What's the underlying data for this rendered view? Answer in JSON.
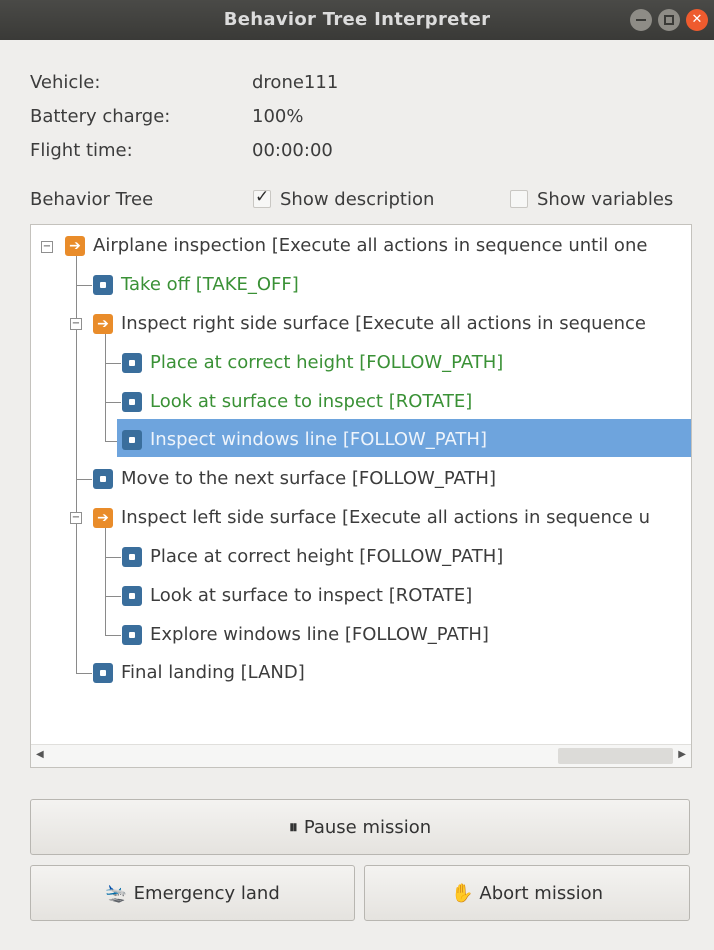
{
  "window": {
    "title": "Behavior Tree Interpreter"
  },
  "info": [
    {
      "label": "Vehicle:",
      "value": "drone111"
    },
    {
      "label": "Battery charge:",
      "value": "100%"
    },
    {
      "label": "Flight time:",
      "value": "00:00:00"
    }
  ],
  "behavior_tree": {
    "label": "Behavior Tree",
    "show_description": {
      "label": "Show description",
      "checked": true
    },
    "show_variables": {
      "label": "Show variables",
      "checked": false
    },
    "nodes": [
      {
        "text": "Airplane inspection [Execute all actions in sequence until one",
        "type": "sequence",
        "status": "normal"
      },
      {
        "text": "Take off [TAKE_OFF]",
        "type": "action",
        "status": "completed"
      },
      {
        "text": "Inspect right side surface [Execute all actions in sequence",
        "type": "sequence",
        "status": "normal"
      },
      {
        "text": "Place at correct height [FOLLOW_PATH]",
        "type": "action",
        "status": "completed"
      },
      {
        "text": "Look at surface to inspect [ROTATE]",
        "type": "action",
        "status": "completed"
      },
      {
        "text": "Inspect windows line [FOLLOW_PATH]",
        "type": "action",
        "status": "selected"
      },
      {
        "text": "Move to the next surface [FOLLOW_PATH]",
        "type": "action",
        "status": "normal"
      },
      {
        "text": "Inspect left side surface [Execute all actions in sequence u",
        "type": "sequence",
        "status": "normal"
      },
      {
        "text": "Place at correct height [FOLLOW_PATH]",
        "type": "action",
        "status": "normal"
      },
      {
        "text": "Look at surface to inspect [ROTATE]",
        "type": "action",
        "status": "normal"
      },
      {
        "text": "Explore windows line [FOLLOW_PATH]",
        "type": "action",
        "status": "normal"
      },
      {
        "text": "Final landing [LAND]",
        "type": "action",
        "status": "normal"
      }
    ]
  },
  "buttons": {
    "pause": {
      "icon": "pause-icon",
      "glyph": "⏸",
      "label": "Pause mission"
    },
    "emergency": {
      "icon": "landing-plane-icon",
      "glyph": "🛬",
      "label": "Emergency land"
    },
    "abort": {
      "icon": "hand-stop-icon",
      "glyph": "✋",
      "label": "Abort mission"
    }
  },
  "colors": {
    "completed": "#3a9136",
    "selected": "#6ea4dd",
    "sequence_icon": "#e98c2a",
    "action_icon": "#3a6e9c",
    "close_button": "#ee5b2e"
  }
}
